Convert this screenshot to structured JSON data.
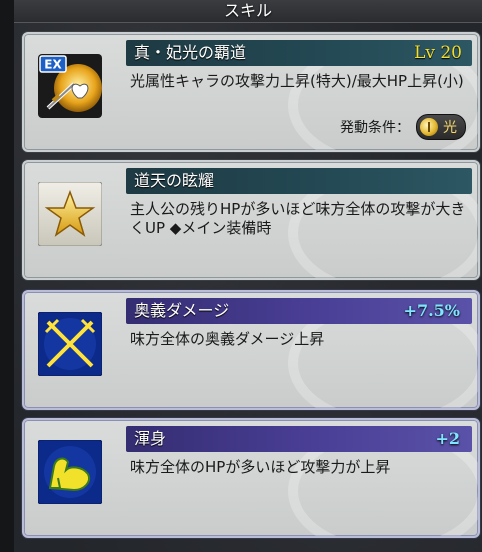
{
  "header": {
    "title": "スキル"
  },
  "skills": [
    {
      "name": "真・妃光の覇道",
      "level": "Lv 20",
      "description": "光属性キャラの攻撃力上昇(特大)/最大HP上昇(小)",
      "condition_label": "発動条件：",
      "condition_value": "光",
      "icon": "ex-sword-heart-icon",
      "icon_badge": "EX"
    },
    {
      "name": "道天の眩耀",
      "description": "主人公の残りHPが多いほど味方全体の攻撃が大きくUP ◆メイン装備時",
      "icon": "star-icon"
    },
    {
      "name": "奥義ダメージ",
      "bonus": "+7.5%",
      "description": "味方全体の奥義ダメージ上昇",
      "icon": "crossed-swords-icon"
    },
    {
      "name": "渾身",
      "bonus": "+2",
      "description": "味方全体のHPが多いほど攻撃力が上昇",
      "icon": "flexed-arm-icon"
    }
  ],
  "colors": {
    "level": "#f4de2c",
    "bonus": "#7fe6ff",
    "title_bar_teal": "#244a55",
    "title_bar_purple": "#4a3f96"
  }
}
